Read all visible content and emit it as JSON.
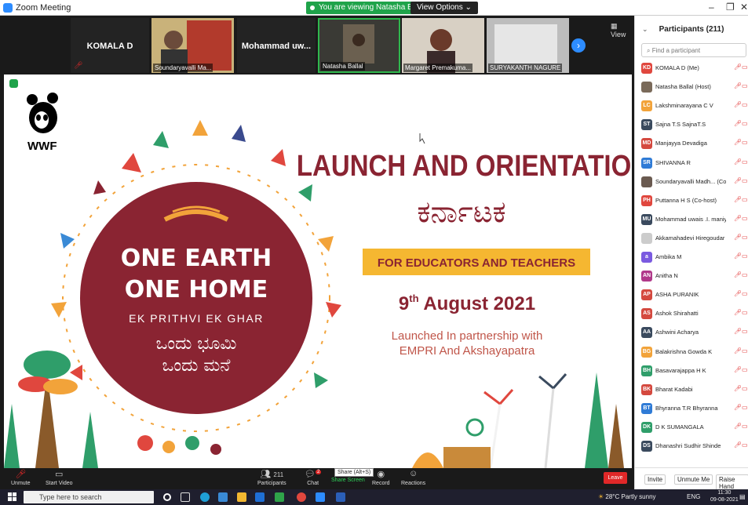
{
  "window": {
    "title": "Zoom Meeting",
    "viewing_banner": "You are viewing Natasha Ballal's screen",
    "view_options": "View Options",
    "minimize": "–",
    "restore": "❐",
    "close": "✕"
  },
  "gallery": {
    "view_label": "View",
    "tiles": [
      {
        "name": "KOMALA D",
        "type": "name"
      },
      {
        "name": "Soundaryavalli Ma...",
        "type": "video"
      },
      {
        "name": "Mohammad uw...",
        "type": "name"
      },
      {
        "name": "Natasha Ballal",
        "type": "video"
      },
      {
        "name": "Margaret Premakuma...",
        "type": "video"
      },
      {
        "name": "SURYAKANTH NAGURE",
        "type": "video"
      }
    ]
  },
  "slide": {
    "logo_text": "WWF",
    "title": "LAUNCH AND ORIENTATION",
    "kannada_title": "ಕರ್ನಾಟಕ",
    "banner": "FOR EDUCATORS AND TEACHERS",
    "date_day": "9",
    "date_suffix": "th",
    "date_rest": " August 2021",
    "partner_line1": "Launched In partnership with",
    "partner_line2": "EMPRI And Akshayapatra",
    "circle_line1": "ONE EARTH",
    "circle_line2": "ONE HOME",
    "circle_line3": "EK PRITHVI EK GHAR",
    "circle_kan1": "ಒಂದು ಭೂಮಿ",
    "circle_kan2": "ಒಂದು ಮನೆ",
    "colors": {
      "maroon": "#8a2432",
      "yellow": "#f5b731"
    }
  },
  "participants_panel": {
    "title": "Participants (211)",
    "search_placeholder": "Find a participant",
    "list": [
      {
        "initials": "KD",
        "name": "KOMALA D (Me)",
        "color": "#e0473e"
      },
      {
        "initials": "",
        "name": "Natasha Ballal (Host)",
        "color": "#7a6a5a"
      },
      {
        "initials": "LC",
        "name": "Lakshminarayana C V",
        "color": "#f2a33a"
      },
      {
        "initials": "ST",
        "name": "Sajna T.S SajnaT.S",
        "color": "#3a4a5e"
      },
      {
        "initials": "MD",
        "name": "Manjayya Devadiga",
        "color": "#d4493f"
      },
      {
        "initials": "SR",
        "name": "SHIVANNA R",
        "color": "#2f7bd6"
      },
      {
        "initials": "",
        "name": "Soundaryavalli Madh... (Co-host)",
        "color": "#6a5a50"
      },
      {
        "initials": "PH",
        "name": "Puttanna H S (Co-host)",
        "color": "#e0473e"
      },
      {
        "initials": "MU",
        "name": "Mohammad uwais .I. maniyar M...",
        "color": "#3a4a5e"
      },
      {
        "initials": "",
        "name": "Akkamahadevi Hiregoudar",
        "color": "#cccccc"
      },
      {
        "initials": "a",
        "name": "Ambika M",
        "color": "#7a5ae0"
      },
      {
        "initials": "AN",
        "name": "Anitha N",
        "color": "#b0398a"
      },
      {
        "initials": "AP",
        "name": "ASHA PURANIK",
        "color": "#d4493f"
      },
      {
        "initials": "AS",
        "name": "Ashok Shirahatti",
        "color": "#d4493f"
      },
      {
        "initials": "AA",
        "name": "Ashwini Acharya",
        "color": "#3a4a5e"
      },
      {
        "initials": "BG",
        "name": "Balakrishna Gowda K",
        "color": "#f2a33a"
      },
      {
        "initials": "BH",
        "name": "Basavarajappa H K",
        "color": "#2f9e6a"
      },
      {
        "initials": "BK",
        "name": "Bharat Kadabi",
        "color": "#d4493f"
      },
      {
        "initials": "BT",
        "name": "Bhyranna T.R Bhyranna",
        "color": "#2f7bd6"
      },
      {
        "initials": "DK",
        "name": "D K SUMANGALA",
        "color": "#2f9e6a"
      },
      {
        "initials": "DS",
        "name": "Dhanashri Sudhir Shinde",
        "color": "#3a4a5e"
      }
    ],
    "footer": {
      "invite": "Invite",
      "unmute_me": "Unmute Me",
      "raise_hand": "Raise Hand"
    }
  },
  "toolbar": {
    "unmute": "Unmute",
    "start_video": "Start Video",
    "participant_count": "211",
    "participants": "Participants",
    "chat": "Chat",
    "chat_badge": "2",
    "share_screen": "Share Screen",
    "share_tooltip": "Share (Alt+S)",
    "record": "Record",
    "reactions": "Reactions",
    "leave": "Leave"
  },
  "taskbar": {
    "search_placeholder": "Type here to search",
    "weather": "28°C  Partly sunny",
    "lang": "ENG",
    "time": "11:30",
    "date": "09-08-2021"
  }
}
